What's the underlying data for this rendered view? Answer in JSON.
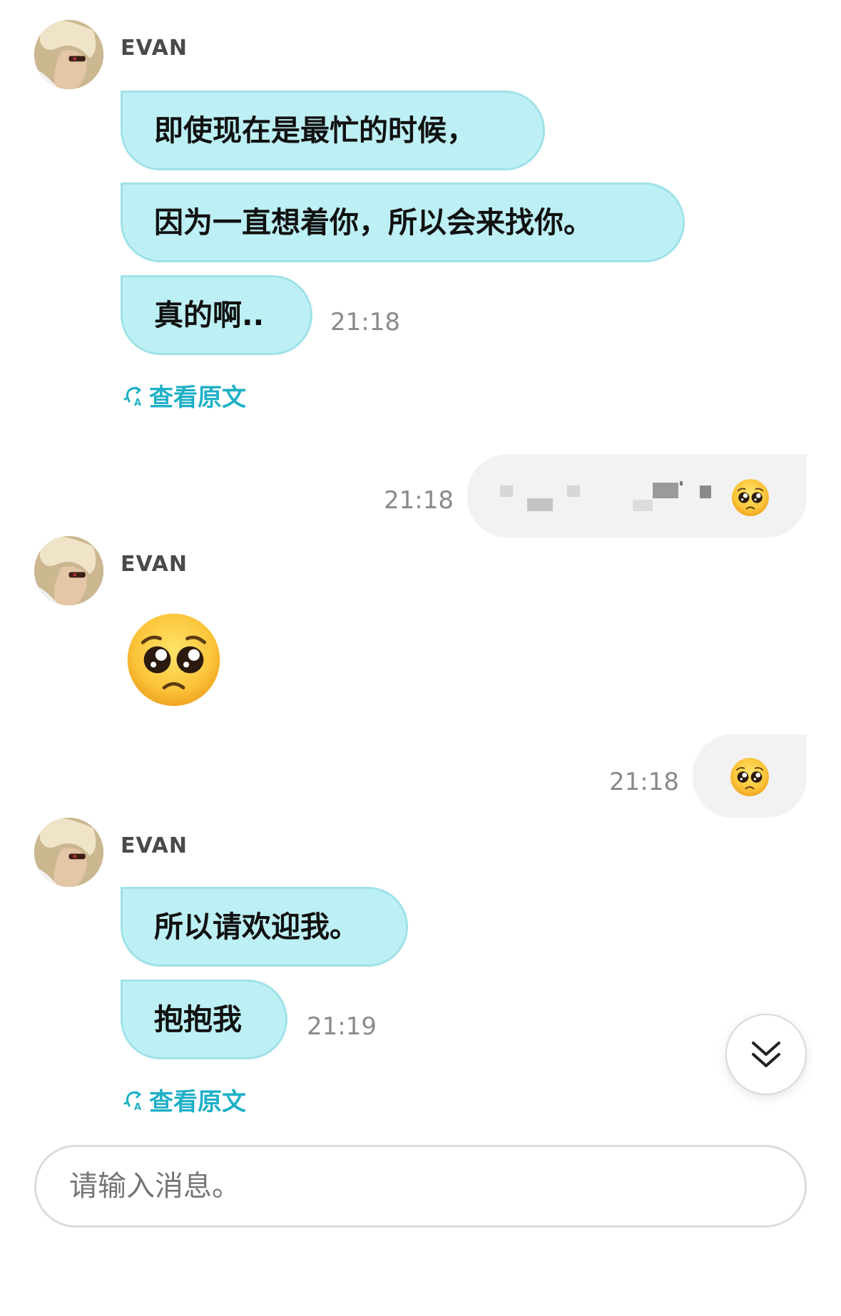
{
  "messages": {
    "group1": {
      "sender": "EVAN",
      "lines": [
        "即使现在是最忙的时候，",
        "因为一直想着你，所以会来找你。",
        "真的啊.."
      ],
      "time": "21:18",
      "view_original": "查看原文"
    },
    "outgoing1": {
      "time": "21:18",
      "content": "redacted-text-with-pleading-face-emoji"
    },
    "group2": {
      "sender": "EVAN",
      "content": "pleading-face-emoji"
    },
    "outgoing2": {
      "time": "21:18",
      "content": "pleading-face-emoji"
    },
    "group3": {
      "sender": "EVAN",
      "lines": [
        "所以请欢迎我。",
        "抱抱我"
      ],
      "time": "21:19",
      "view_original": "查看原文"
    }
  },
  "composer": {
    "placeholder": "请输入消息。"
  },
  "icons": {
    "translate": "refresh-translate-icon",
    "scroll_down": "double-chevron-down-icon",
    "avatar": "user-avatar-photo"
  },
  "colors": {
    "incoming_bubble": "#bdf0f4",
    "outgoing_bubble": "#f2f2f3",
    "accent": "#1eb0c6"
  }
}
